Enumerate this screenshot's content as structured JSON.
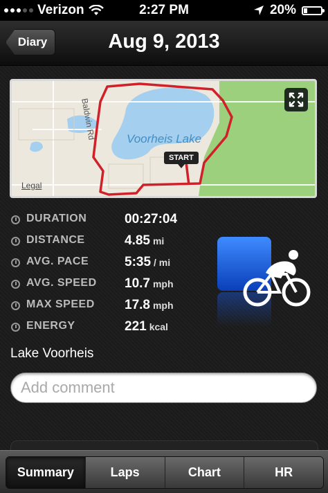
{
  "status_bar": {
    "carrier": "Verizon",
    "time": "2:27 PM",
    "battery": "20%",
    "battery_level": 0.2,
    "icons": [
      "signal-dots-icon",
      "wifi-icon",
      "location-arrow-icon",
      "battery-icon"
    ]
  },
  "nav": {
    "back_label": "Diary",
    "title": "Aug 9, 2013"
  },
  "map": {
    "lake_label": "Voorheis Lake",
    "road_label": "Baldwin Rd",
    "start_label": "START",
    "legal_label": "Legal",
    "route_color": "#d0202a",
    "water_color": "#a5cfee",
    "park_color": "#9cd07c"
  },
  "stats": [
    {
      "label": "DURATION",
      "value": "00:27:04",
      "unit": "",
      "icon": "clock-icon"
    },
    {
      "label": "DISTANCE",
      "value": "4.85",
      "unit": "mi",
      "icon": "distance-icon"
    },
    {
      "label": "AVG. PACE",
      "value": "5:35",
      "unit": "/ mi",
      "icon": "pace-icon"
    },
    {
      "label": "AVG. SPEED",
      "value": "10.7",
      "unit": "mph",
      "icon": "speed-icon"
    },
    {
      "label": "MAX SPEED",
      "value": "17.8",
      "unit": "mph",
      "icon": "max-speed-icon"
    },
    {
      "label": "ENERGY",
      "value": "221",
      "unit": "kcal",
      "icon": "energy-icon"
    }
  ],
  "activity": {
    "type_icon": "cycling-icon",
    "accent": "#1a5fe0"
  },
  "location_name": "Lake Voorheis",
  "comment": {
    "placeholder": "Add comment",
    "value": ""
  },
  "tabs": [
    {
      "label": "Summary",
      "selected": true
    },
    {
      "label": "Laps",
      "selected": false
    },
    {
      "label": "Chart",
      "selected": false
    },
    {
      "label": "HR",
      "selected": false
    }
  ]
}
